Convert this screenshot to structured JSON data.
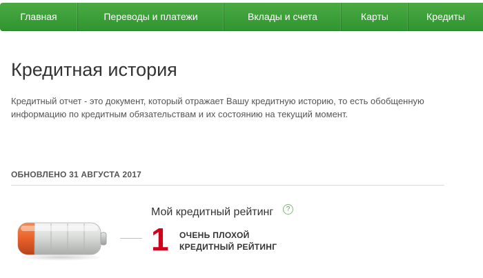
{
  "nav": {
    "items": [
      {
        "label": "Главная"
      },
      {
        "label": "Переводы и платежи"
      },
      {
        "label": "Вклады и счета"
      },
      {
        "label": "Карты"
      },
      {
        "label": "Кредиты"
      }
    ]
  },
  "page": {
    "title": "Кредитная история",
    "intro": "Кредитный отчет - это документ, который отражает Вашу кредитную историю, то есть обобщенную информацию по кредитным обязательствам и их состоянию на текущий момент.",
    "updated": "ОБНОВЛЕНО 31 АВГУСТА 2017"
  },
  "rating": {
    "title": "Мой кредитный рейтинг",
    "help_icon": "?",
    "value": "1",
    "desc_line1": "ОЧЕНЬ ПЛОХОЙ",
    "desc_line2": "КРЕДИТНЫЙ РЕЙТИНГ",
    "battery_level": 1,
    "battery_segments": 5
  },
  "colors": {
    "nav_green": "#3a9f3a",
    "rating_red": "#d0021b",
    "battery_orange": "#e8602a"
  }
}
